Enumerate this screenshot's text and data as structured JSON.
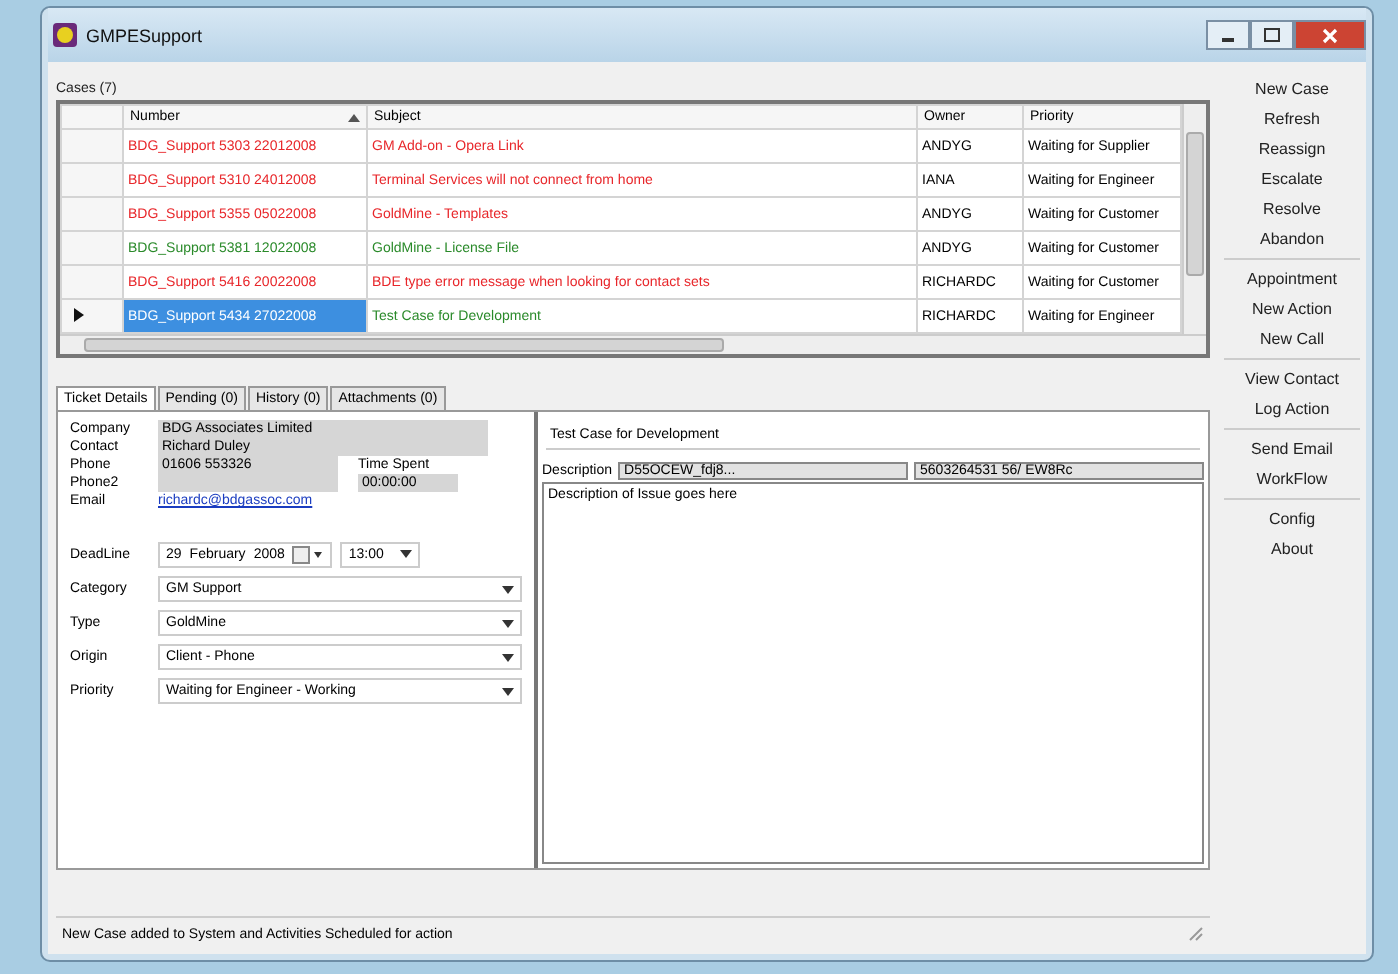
{
  "window": {
    "title": "GMPESupport"
  },
  "cases": {
    "label": "Cases (7)",
    "columns": [
      {
        "label": "Number",
        "sorted": true
      },
      {
        "label": "Subject",
        "sorted": false
      },
      {
        "label": "Owner",
        "sorted": false
      },
      {
        "label": "Priority",
        "sorted": false
      }
    ],
    "rows": [
      {
        "number": "BDG_Support 5303 22012008",
        "subject": "GM Add-on - Opera Link",
        "owner": "ANDYG",
        "priority": "Waiting for Supplier",
        "color": "#e8262a",
        "selected": false
      },
      {
        "number": "BDG_Support 5310 24012008",
        "subject": "Terminal Services will not connect from home",
        "owner": "IANA",
        "priority": "Waiting for Engineer",
        "color": "#e8262a",
        "selected": false
      },
      {
        "number": "BDG_Support 5355 05022008",
        "subject": "GoldMine - Templates",
        "owner": "ANDYG",
        "priority": "Waiting for Customer",
        "color": "#e8262a",
        "selected": false
      },
      {
        "number": "BDG_Support 5381 12022008",
        "subject": "GoldMine - License File",
        "owner": "ANDYG",
        "priority": "Waiting for Customer",
        "color": "#2a8a2a",
        "selected": false
      },
      {
        "number": "BDG_Support 5416 20022008",
        "subject": "BDE type error message when looking for contact sets",
        "owner": "RICHARDC",
        "priority": "Waiting for Customer",
        "color": "#e8262a",
        "selected": false
      },
      {
        "number": "BDG_Support 5434 27022008",
        "subject": "Test Case for Development",
        "owner": "RICHARDC",
        "priority": "Waiting for Engineer",
        "color": "#2a8a2a",
        "selected": true
      }
    ]
  },
  "tabs": [
    {
      "label": "Ticket Details",
      "selected": true
    },
    {
      "label": "Pending (0)",
      "selected": false
    },
    {
      "label": "History (0)",
      "selected": false
    },
    {
      "label": "Attachments (0)",
      "selected": false
    }
  ],
  "details": {
    "company": {
      "label": "Company",
      "value": "BDG Associates Limited"
    },
    "contact": {
      "label": "Contact",
      "value": "Richard Duley"
    },
    "phone": {
      "label": "Phone",
      "value": "01606 553326"
    },
    "phone2": {
      "label": "Phone2"
    },
    "email": {
      "label": "Email",
      "value": "richardc@bdgassoc.com"
    },
    "time_spent": {
      "label": "Time Spent",
      "value": "00:00:00"
    },
    "deadline": {
      "label": "DeadLine",
      "day": "29",
      "month": "February",
      "year": "2008",
      "time": "13:00"
    },
    "dropdowns": [
      {
        "label": "Category",
        "value": "GM Support"
      },
      {
        "label": "Type",
        "value": "GoldMine"
      },
      {
        "label": "Origin",
        "value": "Client - Phone"
      },
      {
        "label": "Priority",
        "value": "Waiting for Engineer - Working"
      }
    ]
  },
  "ticket": {
    "subject": "Test Case for Development",
    "description_label": "Description",
    "description_fields": [
      "D55OCEW_fdj8...",
      "5603264531 56/ EW8Rc"
    ],
    "body": "Description of Issue goes here"
  },
  "actions": [
    [
      "New Case",
      "Refresh",
      "Reassign",
      "Escalate",
      "Resolve",
      "Abandon"
    ],
    [
      "Appointment",
      "New Action",
      "New Call"
    ],
    [
      "View Contact",
      "Log Action"
    ],
    [
      "Send Email",
      "WorkFlow"
    ],
    [
      "Config",
      "About"
    ]
  ],
  "status_bar": "New Case added to System and Activities Scheduled for action"
}
